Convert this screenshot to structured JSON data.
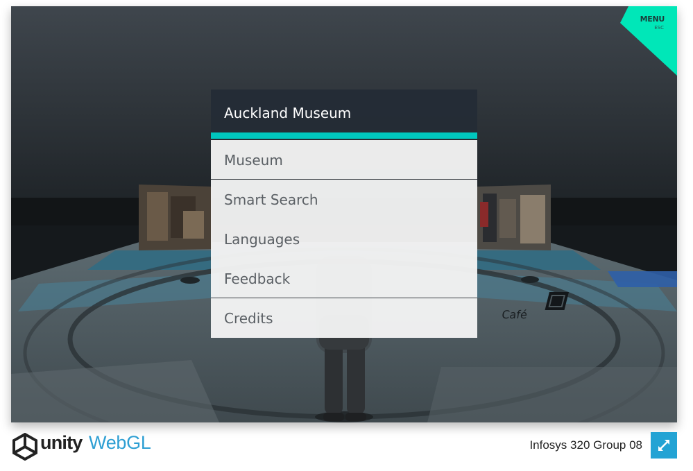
{
  "corner_menu": {
    "label": "MENU",
    "shortcut": "ESC",
    "accent_color": "#00e7b8"
  },
  "dialog": {
    "title": "Auckland Museum",
    "accent_color": "#00c7be",
    "items": [
      {
        "label": "Museum"
      },
      {
        "label": "Smart Search"
      },
      {
        "label": "Languages"
      },
      {
        "label": "Feedback"
      },
      {
        "label": "Credits"
      }
    ]
  },
  "scene": {
    "floor_sign_text": "Café",
    "character_icon": "character-figure"
  },
  "footer": {
    "brand": "unity",
    "platform": "WebGL",
    "project_title": "Infosys 320 Group 08",
    "fullscreen_icon": "expand-arrows-icon",
    "brand_color": "#2e9fd3"
  }
}
